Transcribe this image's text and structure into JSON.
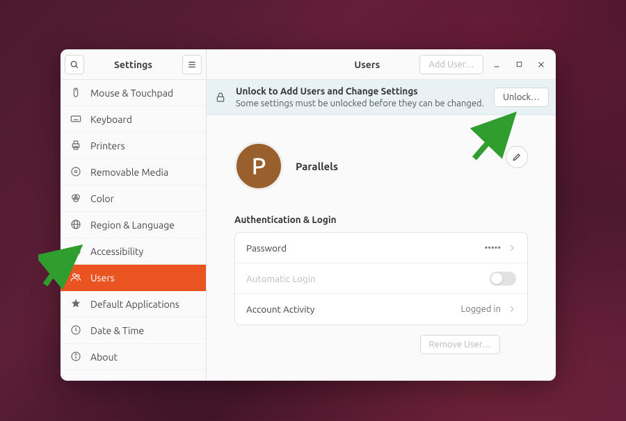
{
  "sidebar": {
    "title": "Settings",
    "items": [
      {
        "label": "Mouse & Touchpad",
        "icon": "mouse",
        "active": false
      },
      {
        "label": "Keyboard",
        "icon": "keyboard",
        "active": false
      },
      {
        "label": "Printers",
        "icon": "printer",
        "active": false
      },
      {
        "label": "Removable Media",
        "icon": "media",
        "active": false
      },
      {
        "label": "Color",
        "icon": "color",
        "active": false
      },
      {
        "label": "Region & Language",
        "icon": "globe",
        "active": false
      },
      {
        "label": "Accessibility",
        "icon": "accessibility",
        "active": false
      },
      {
        "label": "Users",
        "icon": "users",
        "active": true
      },
      {
        "label": "Default Applications",
        "icon": "star",
        "active": false
      },
      {
        "label": "Date & Time",
        "icon": "clock",
        "active": false
      },
      {
        "label": "About",
        "icon": "info",
        "active": false
      }
    ]
  },
  "header": {
    "title": "Users",
    "add_user_label": "Add User…"
  },
  "banner": {
    "title": "Unlock to Add Users and Change Settings",
    "subtitle": "Some settings must be unlocked before they can be changed.",
    "button_label": "Unlock…"
  },
  "user": {
    "avatar_initial": "P",
    "display_name": "Parallels"
  },
  "auth": {
    "section_title": "Authentication & Login",
    "password_label": "Password",
    "password_value": "•••••",
    "auto_login_label": "Automatic Login",
    "activity_label": "Account Activity",
    "activity_value": "Logged in"
  },
  "footer": {
    "remove_user_label": "Remove User…"
  }
}
